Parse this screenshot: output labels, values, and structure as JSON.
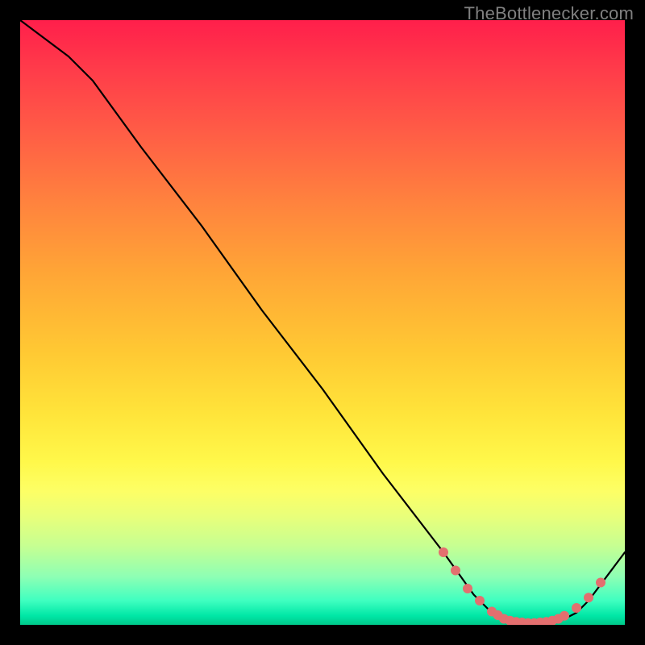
{
  "attribution": "TheBottlenecker.com",
  "chart_data": {
    "type": "line",
    "title": "",
    "xlabel": "",
    "ylabel": "",
    "xlim": [
      0,
      100
    ],
    "ylim": [
      0,
      100
    ],
    "series": [
      {
        "name": "curve",
        "x": [
          0,
          8,
          12,
          20,
          30,
          40,
          50,
          60,
          70,
          75,
          78,
          80,
          82,
          85,
          88,
          90,
          92,
          94,
          100
        ],
        "values": [
          100,
          94,
          90,
          79,
          66,
          52,
          39,
          25,
          12,
          5,
          2,
          1,
          0.5,
          0.3,
          0.5,
          1,
          2,
          4,
          12
        ]
      }
    ],
    "markers": {
      "name": "highlight-dots",
      "color": "#e36f6f",
      "x": [
        70,
        72,
        74,
        76,
        78,
        79,
        80,
        81,
        82,
        83,
        84,
        85,
        86,
        87,
        88,
        89,
        90,
        92,
        94,
        96
      ],
      "values": [
        12,
        9,
        6,
        4,
        2.2,
        1.6,
        1,
        0.7,
        0.5,
        0.4,
        0.3,
        0.3,
        0.4,
        0.5,
        0.7,
        1,
        1.5,
        2.8,
        4.5,
        7
      ]
    }
  }
}
